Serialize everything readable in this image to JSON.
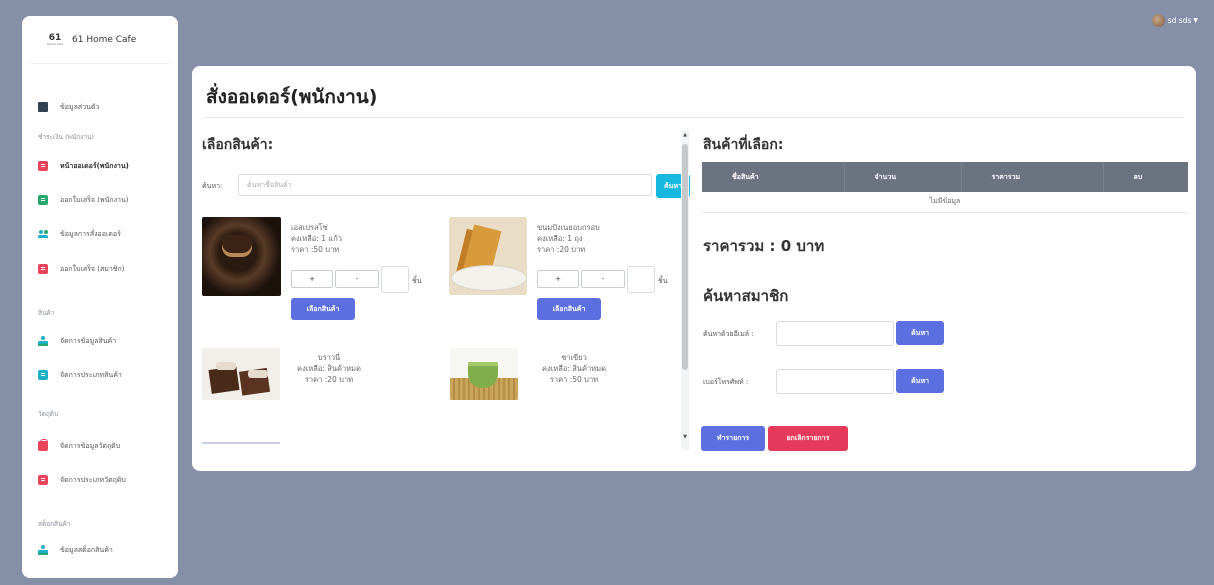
{
  "brand": {
    "logo_number": "61",
    "logo_sub": "Home cafe",
    "name": "61 Home Cafe"
  },
  "user": {
    "name": "sd sds"
  },
  "sidebar": {
    "items": [
      {
        "label": "ข้อมูลส่วนตัว",
        "icon": "id-card-icon"
      },
      {
        "label": "หน้าออเดอร์(พนักงาน)",
        "icon": "receipt-icon"
      },
      {
        "label": "ออกใบเสร็จ (พนักงาน)",
        "icon": "receipt-icon"
      },
      {
        "label": "ข้อมูลการสั่งออเดอร์",
        "icon": "users-icon"
      },
      {
        "label": "ออกใบเสร็จ (สมาชิก)",
        "icon": "receipt-icon"
      },
      {
        "label": "จัดการข้อมูลสินค้า",
        "icon": "people-icon"
      },
      {
        "label": "จัดการประเภทสินค้า",
        "icon": "receipt-icon"
      },
      {
        "label": "จัดการข้อมูลวัตถุดิบ",
        "icon": "shop-icon"
      },
      {
        "label": "จัดการประเภทวัตถุดิบ",
        "icon": "receipt-icon"
      },
      {
        "label": "ข้อมูลสต็อกสินค้า",
        "icon": "people-icon"
      }
    ],
    "headings": [
      "ชำระเงิน (พนักงาน)",
      "สินค้า",
      "วัตถุดิบ",
      "สต็อกสินค้า"
    ]
  },
  "main": {
    "title": "สั่งออเดอร์(พนักงาน)",
    "choose_title": "เลือกสินค้า:",
    "search_label": "ค้นหา:",
    "search_placeholder": "ค้นหาชื่อสินค้า",
    "search_button": "ค้นหา",
    "qty_plus": "+",
    "qty_minus": "-",
    "unit": "ชิ้น",
    "select_button": "เลือกสินค้า",
    "products": [
      {
        "name": "เอสเปรสโซ่",
        "stock": "คงเหลือ: 1 แก้ว",
        "price": "ราคา :50 บาท"
      },
      {
        "name": "ขนมปังเนยอบกรอบ",
        "stock": "คงเหลือ: 1 ถุง",
        "price": "ราคา :20 บาท"
      },
      {
        "name": "บราวนี่",
        "stock": "คงเหลือ: สินค้าหมด",
        "price": "ราคา :20 บาท"
      },
      {
        "name": "ชาเขียว",
        "stock": "คงเหลือ: สินค้าหมด",
        "price": "ราคา :50 บาท"
      }
    ]
  },
  "selected": {
    "title": "สินค้าที่เลือก:",
    "columns": [
      "ชื่อสินค้า",
      "จำนวน",
      "ราคารวม",
      "ลบ"
    ],
    "empty_text": "ไม่มีข้อมูล",
    "total": "ราคารวม : 0 บาท"
  },
  "member": {
    "title": "ค้นหาสมาชิก",
    "email_label": "ค้นหาด้วยอีเมล์ :",
    "phone_label": "เบอร์โทรศัพท์ :",
    "search_button": "ค้นหา",
    "submit_button": "ทำรายการ",
    "cancel_button": "ยกเลิกรายการ"
  }
}
